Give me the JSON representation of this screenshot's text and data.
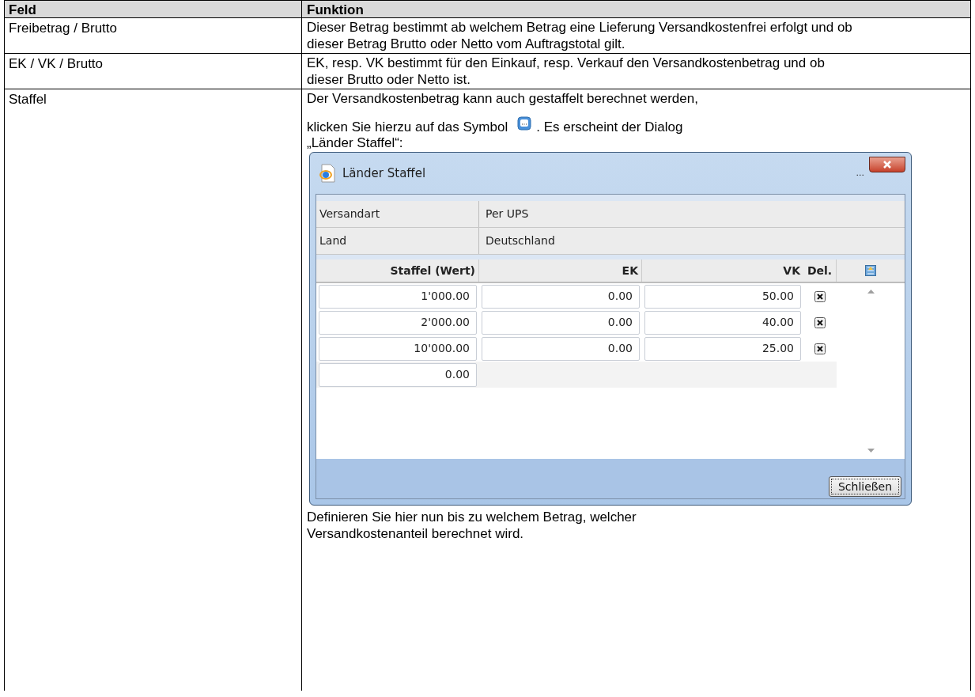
{
  "table": {
    "columns": [
      "Feld",
      "Funktion"
    ],
    "rows": [
      {
        "field": "Freibetrag / Brutto",
        "text": "Dieser Betrag bestimmt ab welchem Betrag eine Lieferung Versandkostenfrei erfolgt und ob dieser Betrag Brutto oder Netto vom Auftragstotal gilt."
      },
      {
        "field": "EK / VK / Brutto",
        "text": "EK, resp. VK bestimmt für den Einkauf, resp. Verkauf den Versandkostenbetrag und ob dieser Brutto oder Netto ist."
      },
      {
        "field": "Staffel",
        "text_first_line": "Der Versandkostenbetrag kann auch gestaffelt berechnet werden,",
        "text_before_icon": "klicken Sie hierzu auf das Symbol",
        "text_after_icon": ". Es erscheint der Dialog",
        "text_last_line": "„Länder Staffel“:",
        "text_after_dialog": "Definieren Sie hier nun bis zu welchem Betrag, welcher Versandkostenanteil berechnet wird."
      }
    ]
  },
  "dialog": {
    "title": "Länder Staffel",
    "title_suffix": "...",
    "info": [
      {
        "label": "Versandart",
        "value": "Per UPS"
      },
      {
        "label": "Land",
        "value": "Deutschland"
      }
    ],
    "columns": [
      "Staffel (Wert)",
      "EK",
      "VK",
      "Del."
    ],
    "rows": [
      {
        "wert": "1'000.00",
        "ek": "0.00",
        "vk": "50.00",
        "delete": true
      },
      {
        "wert": "2'000.00",
        "ek": "0.00",
        "vk": "40.00",
        "delete": true
      },
      {
        "wert": "10'000.00",
        "ek": "0.00",
        "vk": "25.00",
        "delete": true
      },
      {
        "wert": "0.00",
        "delete": false
      }
    ],
    "close_button": "Schließen"
  }
}
